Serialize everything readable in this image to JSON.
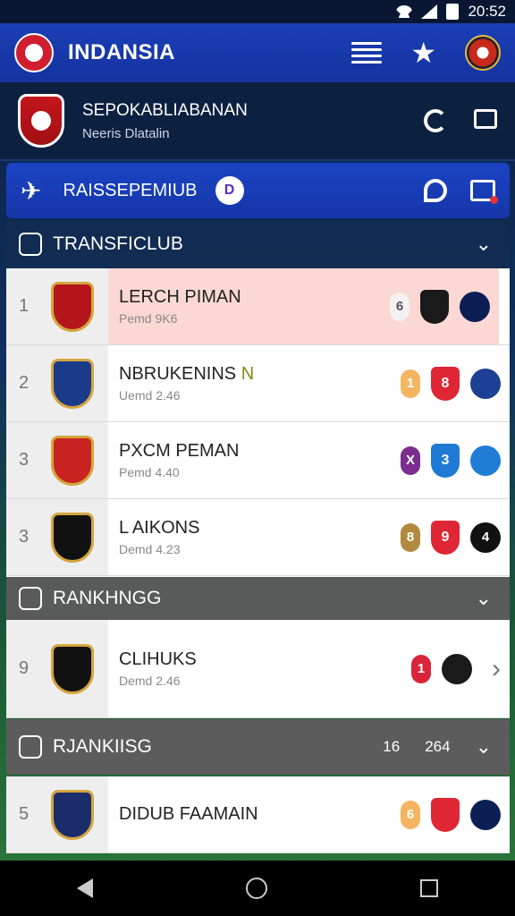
{
  "status_bar": {
    "time": "20:52"
  },
  "app_bar": {
    "title": "INDANSIA"
  },
  "club_bar": {
    "name": "SEPOKABLIABANAN",
    "subtitle": "Neeris Dlatalin"
  },
  "tab_bar": {
    "title": "RAISSEPEMIUB",
    "badge": "D"
  },
  "sections": [
    {
      "title": "TRANSFICLUB",
      "rows": [
        {
          "rank": "1",
          "name": "LERCH PIMAN",
          "meta": "Pemd 9K6",
          "highlight": true,
          "badges": [
            {
              "text": "6",
              "color": "#f2f2f2",
              "textColor": "#555"
            },
            {
              "text": "",
              "color": "#1a1a1a"
            },
            {
              "text": "",
              "color": "#0c1f55"
            }
          ],
          "crest_color": "#b4151b"
        },
        {
          "rank": "2",
          "name": "NBRUKENINS",
          "name_accent": "N",
          "meta": "Uemd 2.46",
          "highlight": false,
          "badges": [
            {
              "text": "1",
              "color": "#f3b560"
            },
            {
              "text": "8",
              "color": "#df2634"
            },
            {
              "text": "",
              "color": "#1d3f94"
            }
          ],
          "crest_color": "#1a3a8a"
        },
        {
          "rank": "3",
          "name": "PXCM PEMAN",
          "meta": "Pemd 4.40",
          "highlight": false,
          "badges": [
            {
              "text": "X",
              "color": "#7c2e8f"
            },
            {
              "text": "3",
              "color": "#1e7ad4"
            },
            {
              "text": "",
              "color": "#1f7dd6"
            }
          ],
          "crest_color": "#c82320"
        },
        {
          "rank": "3",
          "name": "L AIKONS",
          "meta": "Demd 4.23",
          "highlight": false,
          "badges": [
            {
              "text": "8",
              "color": "#b08a3e"
            },
            {
              "text": "9",
              "color": "#df2634"
            },
            {
              "text": "4",
              "color": "#111"
            }
          ],
          "crest_color": "#111"
        }
      ]
    },
    {
      "title": "RANKHNGG",
      "rows": [
        {
          "rank": "9",
          "name": "CLIHUKS",
          "meta": "Demd 2.46",
          "highlight": false,
          "badges": [
            {
              "text": "1",
              "color": "#d9243a"
            },
            {
              "text": "",
              "color": "#1a1a1a"
            }
          ],
          "crest_color": "#111",
          "arrow": "›"
        }
      ]
    },
    {
      "title": "RJANKIISG",
      "numbers": [
        "16",
        "264"
      ],
      "rows": [
        {
          "rank": "5",
          "name": "DIDUB FAAMAIN",
          "meta": "",
          "highlight": false,
          "badges": [
            {
              "text": "6",
              "color": "#f3b560"
            },
            {
              "text": "",
              "color": "#df2634"
            },
            {
              "text": "",
              "color": "#0c1f55"
            }
          ],
          "crest_color": "#1a2c6a"
        }
      ]
    }
  ],
  "colors": {
    "primary": "#1a3fb5",
    "accent_red": "#df2634",
    "highlight": "#fbd8d3"
  }
}
